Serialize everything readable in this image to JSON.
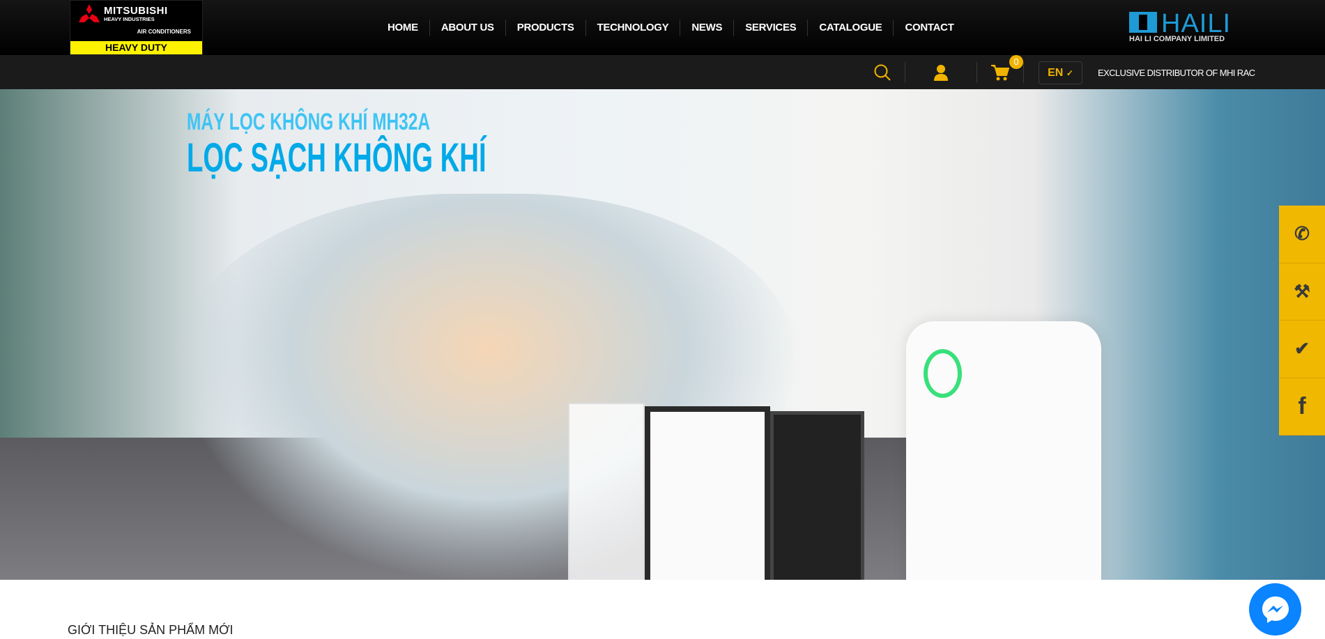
{
  "brand": {
    "logo_line1": "MITSUBISHI",
    "logo_line2": "HEAVY INDUSTRIES",
    "logo_line3": "AIR CONDITIONERS",
    "logo_badge": "HEAVY DUTY",
    "partner_logo": "HAILI",
    "partner_subtitle": "HAI LI COMPANY LIMITED"
  },
  "nav": [
    "HOME",
    "ABOUT US",
    "PRODUCTS",
    "TECHNOLOGY",
    "NEWS",
    "SERVICES",
    "CATALOGUE",
    "CONTACT"
  ],
  "toolbar": {
    "search_icon": "search-icon",
    "user_icon": "user-icon",
    "cart_icon": "cart-icon",
    "cart_count": "0",
    "language": "EN",
    "tagline": "EXCLUSIVE DISTRIBUTOR OF MHI RAC"
  },
  "hero": {
    "subtitle": "MÁY LỌC KHÔNG KHÍ MH32A",
    "title": "LỌC SẠCH KHÔNG KHÍ"
  },
  "side_buttons": [
    "phone-icon",
    "service-tools-icon",
    "warranty-shield-icon",
    "facebook-icon"
  ],
  "section": {
    "title": "GIỚI THIỆU SẢN PHẨM MỚI"
  },
  "colors": {
    "accent": "#f0b800",
    "hero_text": "#00a9e8",
    "messenger": "#0a84ff"
  }
}
